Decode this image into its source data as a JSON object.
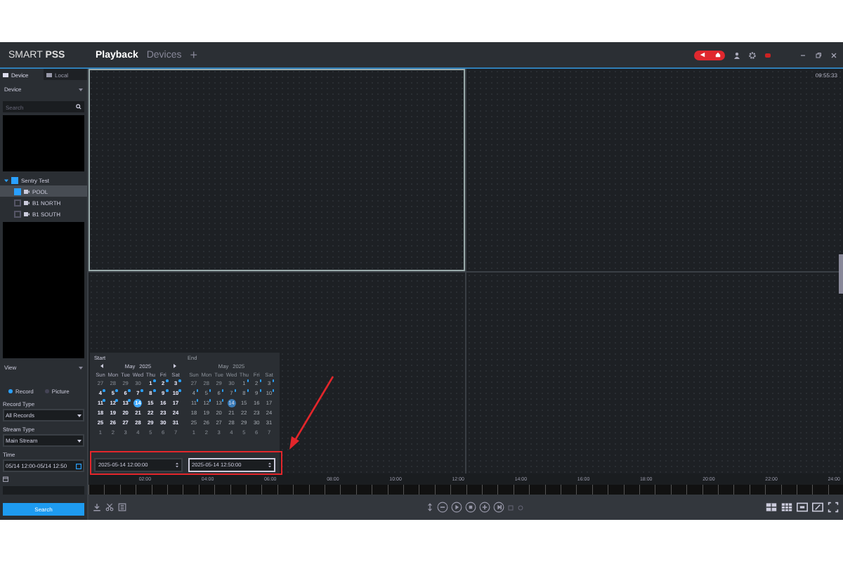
{
  "title_bar": {
    "logo": "SMART **PSS**",
    "tabs": [
      {
        "label": "Playback",
        "selected": true
      },
      {
        "label": "Devices",
        "selected": false
      }
    ],
    "add_tab": "+",
    "clock": "09:55:33"
  },
  "sidebar": {
    "tabs": [
      {
        "label": "Device",
        "selected": true
      },
      {
        "label": "Local",
        "selected": false
      }
    ],
    "device_select": "Device",
    "search": {
      "placeholder": "Search"
    },
    "tree": [
      {
        "label": "Sentry Test",
        "checked": true,
        "expanded": true,
        "selected": false,
        "children": [
          {
            "label": "POOL",
            "checked": true,
            "selected": true
          },
          {
            "label": "B1 NORTH",
            "checked": false,
            "selected": false
          },
          {
            "label": "B1 SOUTH",
            "checked": false,
            "selected": false
          }
        ]
      }
    ],
    "view_select": "View",
    "source": [
      {
        "label": "Record",
        "selected": true
      },
      {
        "label": "Picture",
        "selected": false
      }
    ],
    "record_type": {
      "label": "Record Type",
      "value": "All Records"
    },
    "stream_type": {
      "label": "Stream Type",
      "value": "Main Stream"
    },
    "time": {
      "label": "Time",
      "value": "05/14 12:00-05/14 12:50"
    },
    "search_button": "Search"
  },
  "calendar": {
    "panels": [
      {
        "label": "Start",
        "month": "May",
        "year": "2025",
        "dimmed": false,
        "value": "2025-05-14 12:00:00",
        "focused": false,
        "weekdays": [
          "Sun",
          "Mon",
          "Tue",
          "Wed",
          "Thu",
          "Fri",
          "Sat"
        ],
        "days": [
          {
            "n": "27",
            "outside": true,
            "record": false,
            "selected": false
          },
          {
            "n": "28",
            "outside": true,
            "record": false,
            "selected": false
          },
          {
            "n": "29",
            "outside": true,
            "record": false,
            "selected": false
          },
          {
            "n": "30",
            "outside": true,
            "record": false,
            "selected": false
          },
          {
            "n": "1",
            "outside": false,
            "record": true,
            "selected": false
          },
          {
            "n": "2",
            "outside": false,
            "record": true,
            "selected": false
          },
          {
            "n": "3",
            "outside": false,
            "record": true,
            "selected": false
          },
          {
            "n": "4",
            "outside": false,
            "record": true,
            "selected": false
          },
          {
            "n": "5",
            "outside": false,
            "record": true,
            "selected": false
          },
          {
            "n": "6",
            "outside": false,
            "record": true,
            "selected": false
          },
          {
            "n": "7",
            "outside": false,
            "record": true,
            "selected": false
          },
          {
            "n": "8",
            "outside": false,
            "record": true,
            "selected": false
          },
          {
            "n": "9",
            "outside": false,
            "record": true,
            "selected": false
          },
          {
            "n": "10",
            "outside": false,
            "record": true,
            "selected": false
          },
          {
            "n": "11",
            "outside": false,
            "record": true,
            "selected": false
          },
          {
            "n": "12",
            "outside": false,
            "record": true,
            "selected": false
          },
          {
            "n": "13",
            "outside": false,
            "record": true,
            "selected": false
          },
          {
            "n": "14",
            "outside": false,
            "record": false,
            "selected": true
          },
          {
            "n": "15",
            "outside": false,
            "record": false,
            "selected": false
          },
          {
            "n": "16",
            "outside": false,
            "record": false,
            "selected": false
          },
          {
            "n": "17",
            "outside": false,
            "record": false,
            "selected": false
          },
          {
            "n": "18",
            "outside": false,
            "record": false,
            "selected": false
          },
          {
            "n": "19",
            "outside": false,
            "record": false,
            "selected": false
          },
          {
            "n": "20",
            "outside": false,
            "record": false,
            "selected": false
          },
          {
            "n": "21",
            "outside": false,
            "record": false,
            "selected": false
          },
          {
            "n": "22",
            "outside": false,
            "record": false,
            "selected": false
          },
          {
            "n": "23",
            "outside": false,
            "record": false,
            "selected": false
          },
          {
            "n": "24",
            "outside": false,
            "record": false,
            "selected": false
          },
          {
            "n": "25",
            "outside": false,
            "record": false,
            "selected": false
          },
          {
            "n": "26",
            "outside": false,
            "record": false,
            "selected": false
          },
          {
            "n": "27",
            "outside": false,
            "record": false,
            "selected": false
          },
          {
            "n": "28",
            "outside": false,
            "record": false,
            "selected": false
          },
          {
            "n": "29",
            "outside": false,
            "record": false,
            "selected": false
          },
          {
            "n": "30",
            "outside": false,
            "record": false,
            "selected": false
          },
          {
            "n": "31",
            "outside": false,
            "record": false,
            "selected": false
          },
          {
            "n": "1",
            "outside": true,
            "record": false,
            "selected": false
          },
          {
            "n": "2",
            "outside": true,
            "record": false,
            "selected": false
          },
          {
            "n": "3",
            "outside": true,
            "record": false,
            "selected": false
          },
          {
            "n": "4",
            "outside": true,
            "record": false,
            "selected": false
          },
          {
            "n": "5",
            "outside": true,
            "record": false,
            "selected": false
          },
          {
            "n": "6",
            "outside": true,
            "record": false,
            "selected": false
          },
          {
            "n": "7",
            "outside": true,
            "record": false,
            "selected": false
          }
        ]
      },
      {
        "label": "End",
        "month": "May",
        "year": "2025",
        "dimmed": true,
        "value": "2025-05-14 12:50:00",
        "focused": true,
        "weekdays": [
          "Sun",
          "Mon",
          "Tue",
          "Wed",
          "Thu",
          "Fri",
          "Sat"
        ],
        "days": [
          {
            "n": "27",
            "outside": true,
            "record": false,
            "selected": false
          },
          {
            "n": "28",
            "outside": true,
            "record": false,
            "selected": false
          },
          {
            "n": "29",
            "outside": true,
            "record": false,
            "selected": false
          },
          {
            "n": "30",
            "outside": true,
            "record": false,
            "selected": false
          },
          {
            "n": "1",
            "outside": false,
            "record": true,
            "selected": false
          },
          {
            "n": "2",
            "outside": false,
            "record": true,
            "selected": false
          },
          {
            "n": "3",
            "outside": false,
            "record": true,
            "selected": false
          },
          {
            "n": "4",
            "outside": false,
            "record": true,
            "selected": false
          },
          {
            "n": "5",
            "outside": false,
            "record": true,
            "selected": false
          },
          {
            "n": "6",
            "outside": false,
            "record": true,
            "selected": false
          },
          {
            "n": "7",
            "outside": false,
            "record": true,
            "selected": false
          },
          {
            "n": "8",
            "outside": false,
            "record": true,
            "selected": false
          },
          {
            "n": "9",
            "outside": false,
            "record": true,
            "selected": false
          },
          {
            "n": "10",
            "outside": false,
            "record": true,
            "selected": false
          },
          {
            "n": "11",
            "outside": false,
            "record": true,
            "selected": false
          },
          {
            "n": "12",
            "outside": false,
            "record": true,
            "selected": false
          },
          {
            "n": "13",
            "outside": false,
            "record": true,
            "selected": false
          },
          {
            "n": "14",
            "outside": false,
            "record": false,
            "selected": true
          },
          {
            "n": "15",
            "outside": false,
            "record": false,
            "selected": false
          },
          {
            "n": "16",
            "outside": false,
            "record": false,
            "selected": false
          },
          {
            "n": "17",
            "outside": false,
            "record": false,
            "selected": false
          },
          {
            "n": "18",
            "outside": false,
            "record": false,
            "selected": false
          },
          {
            "n": "19",
            "outside": false,
            "record": false,
            "selected": false
          },
          {
            "n": "20",
            "outside": false,
            "record": false,
            "selected": false
          },
          {
            "n": "21",
            "outside": false,
            "record": false,
            "selected": false
          },
          {
            "n": "22",
            "outside": false,
            "record": false,
            "selected": false
          },
          {
            "n": "23",
            "outside": false,
            "record": false,
            "selected": false
          },
          {
            "n": "24",
            "outside": false,
            "record": false,
            "selected": false
          },
          {
            "n": "25",
            "outside": false,
            "record": false,
            "selected": false
          },
          {
            "n": "26",
            "outside": false,
            "record": false,
            "selected": false
          },
          {
            "n": "27",
            "outside": false,
            "record": false,
            "selected": false
          },
          {
            "n": "28",
            "outside": false,
            "record": false,
            "selected": false
          },
          {
            "n": "29",
            "outside": false,
            "record": false,
            "selected": false
          },
          {
            "n": "30",
            "outside": false,
            "record": false,
            "selected": false
          },
          {
            "n": "31",
            "outside": false,
            "record": false,
            "selected": false
          },
          {
            "n": "1",
            "outside": true,
            "record": false,
            "selected": false
          },
          {
            "n": "2",
            "outside": true,
            "record": false,
            "selected": false
          },
          {
            "n": "3",
            "outside": true,
            "record": false,
            "selected": false
          },
          {
            "n": "4",
            "outside": true,
            "record": false,
            "selected": false
          },
          {
            "n": "5",
            "outside": true,
            "record": false,
            "selected": false
          },
          {
            "n": "6",
            "outside": true,
            "record": false,
            "selected": false
          },
          {
            "n": "7",
            "outside": true,
            "record": false,
            "selected": false
          }
        ]
      }
    ]
  },
  "timeline": [
    "02:00",
    "04:00",
    "06:00",
    "08:00",
    "10:00",
    "12:00",
    "14:00",
    "16:00",
    "18:00",
    "20:00",
    "22:00",
    "24:00"
  ]
}
